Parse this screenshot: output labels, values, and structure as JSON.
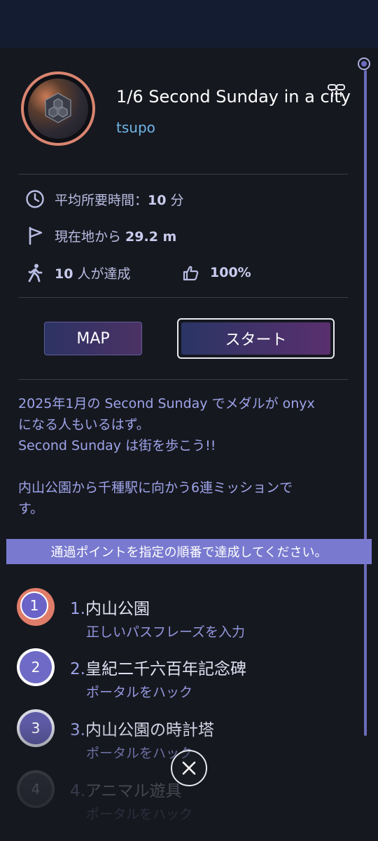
{
  "mission": {
    "title": "1/6 Second Sunday in a city",
    "author": "tsupo"
  },
  "stats": {
    "time_label": "平均所要時間：",
    "time_value": "10",
    "time_unit": " 分",
    "distance_label": "現在地から ",
    "distance_value": "29.2 m",
    "completed_value": "10",
    "completed_label": " 人が達成",
    "rating_value": "100%"
  },
  "buttons": {
    "map_label": "MAP",
    "start_label": "スタート"
  },
  "description": [
    "2025年1月の Second Sunday でメダルが onyx",
    "になる人もいるはず。",
    "Second Sunday は街を歩こう!!",
    "",
    "内山公園から千種駅に向かう6連ミッションで",
    "す。"
  ],
  "banner": "通過ポイントを指定の順番で達成してください。",
  "steps": [
    {
      "badge": "1",
      "num": "1.",
      "name": "内山公園",
      "sub": "正しいパスフレーズを入力"
    },
    {
      "badge": "2",
      "num": "2.",
      "name": "皇紀二千六百年記念碑",
      "sub": "ポータルをハック"
    },
    {
      "badge": "3",
      "num": "3.",
      "name": "内山公園の時計塔",
      "sub": "ポータルをハック"
    },
    {
      "badge": "4",
      "num": "4.",
      "name": "アニマル遊具",
      "sub": "ポータルをハック"
    }
  ],
  "icons": {
    "time": "clock-icon",
    "distance": "flag-icon",
    "completed": "walker-icon",
    "rating": "thumbs-up-icon",
    "link": "link-icon",
    "close": "close-icon"
  },
  "colors": {
    "accent": "#7879cf",
    "link": "#6fb6ea",
    "avatar_ring": "#d98570"
  }
}
